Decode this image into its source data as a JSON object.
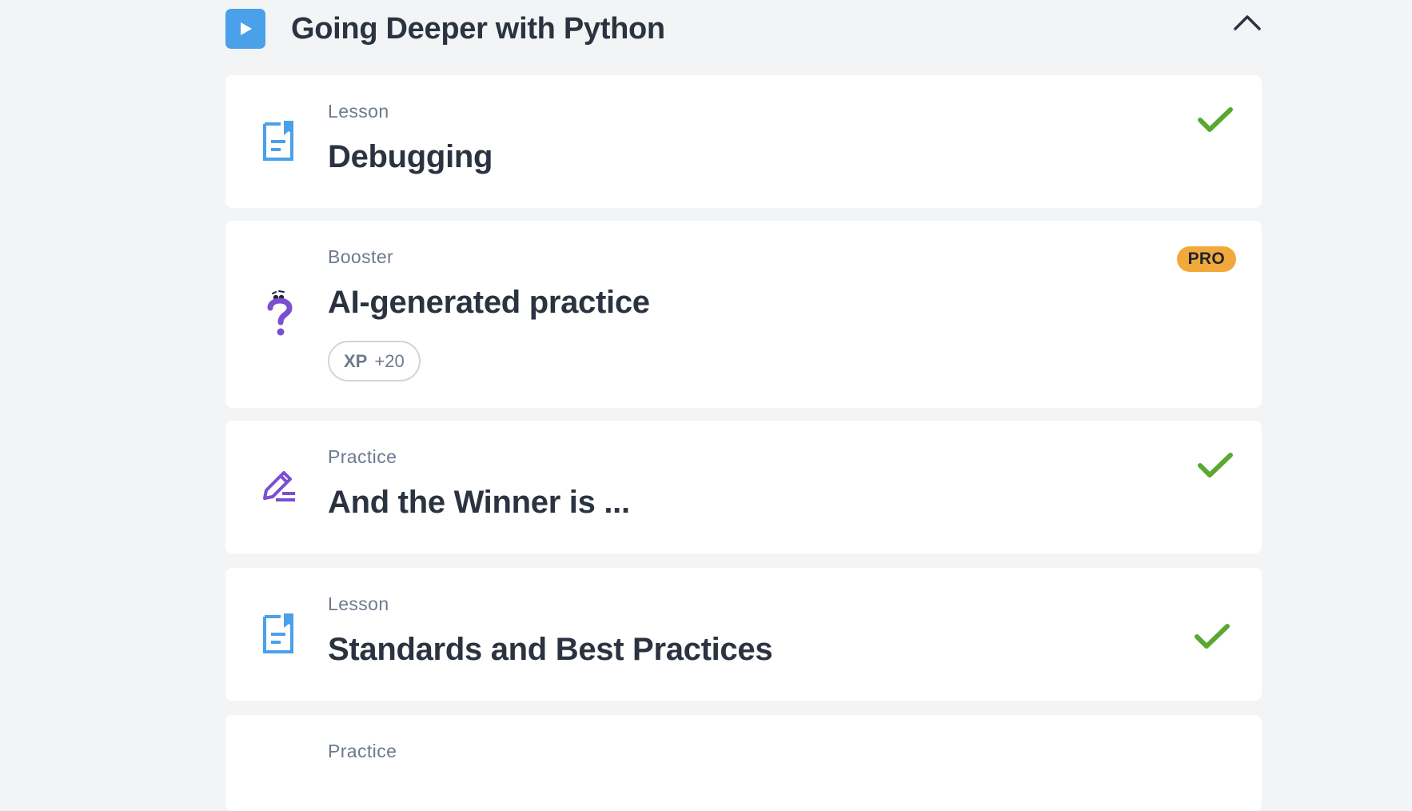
{
  "section": {
    "title": "Going Deeper with Python",
    "icon": "play-icon",
    "accent": "#4ba0ea"
  },
  "items": [
    {
      "type": "Lesson",
      "title": "Debugging",
      "icon": "lesson-document-icon",
      "completed": true
    },
    {
      "type": "Booster",
      "title": "AI-generated practice",
      "icon": "question-mark-character-icon",
      "badge": "PRO",
      "xp_label": "XP",
      "xp_value": "+20"
    },
    {
      "type": "Practice",
      "title": "And the Winner is ...",
      "icon": "pencil-icon",
      "completed": true
    },
    {
      "type": "Lesson",
      "title": "Standards and Best Practices",
      "icon": "lesson-document-icon",
      "completed": true
    },
    {
      "type": "Practice",
      "title": "",
      "icon": "pencil-icon"
    }
  ],
  "colors": {
    "check": "#5aa832",
    "pro": "#f2a93b",
    "lesson_icon": "#4ba0ea",
    "practice_icon": "#7a4fd1"
  }
}
